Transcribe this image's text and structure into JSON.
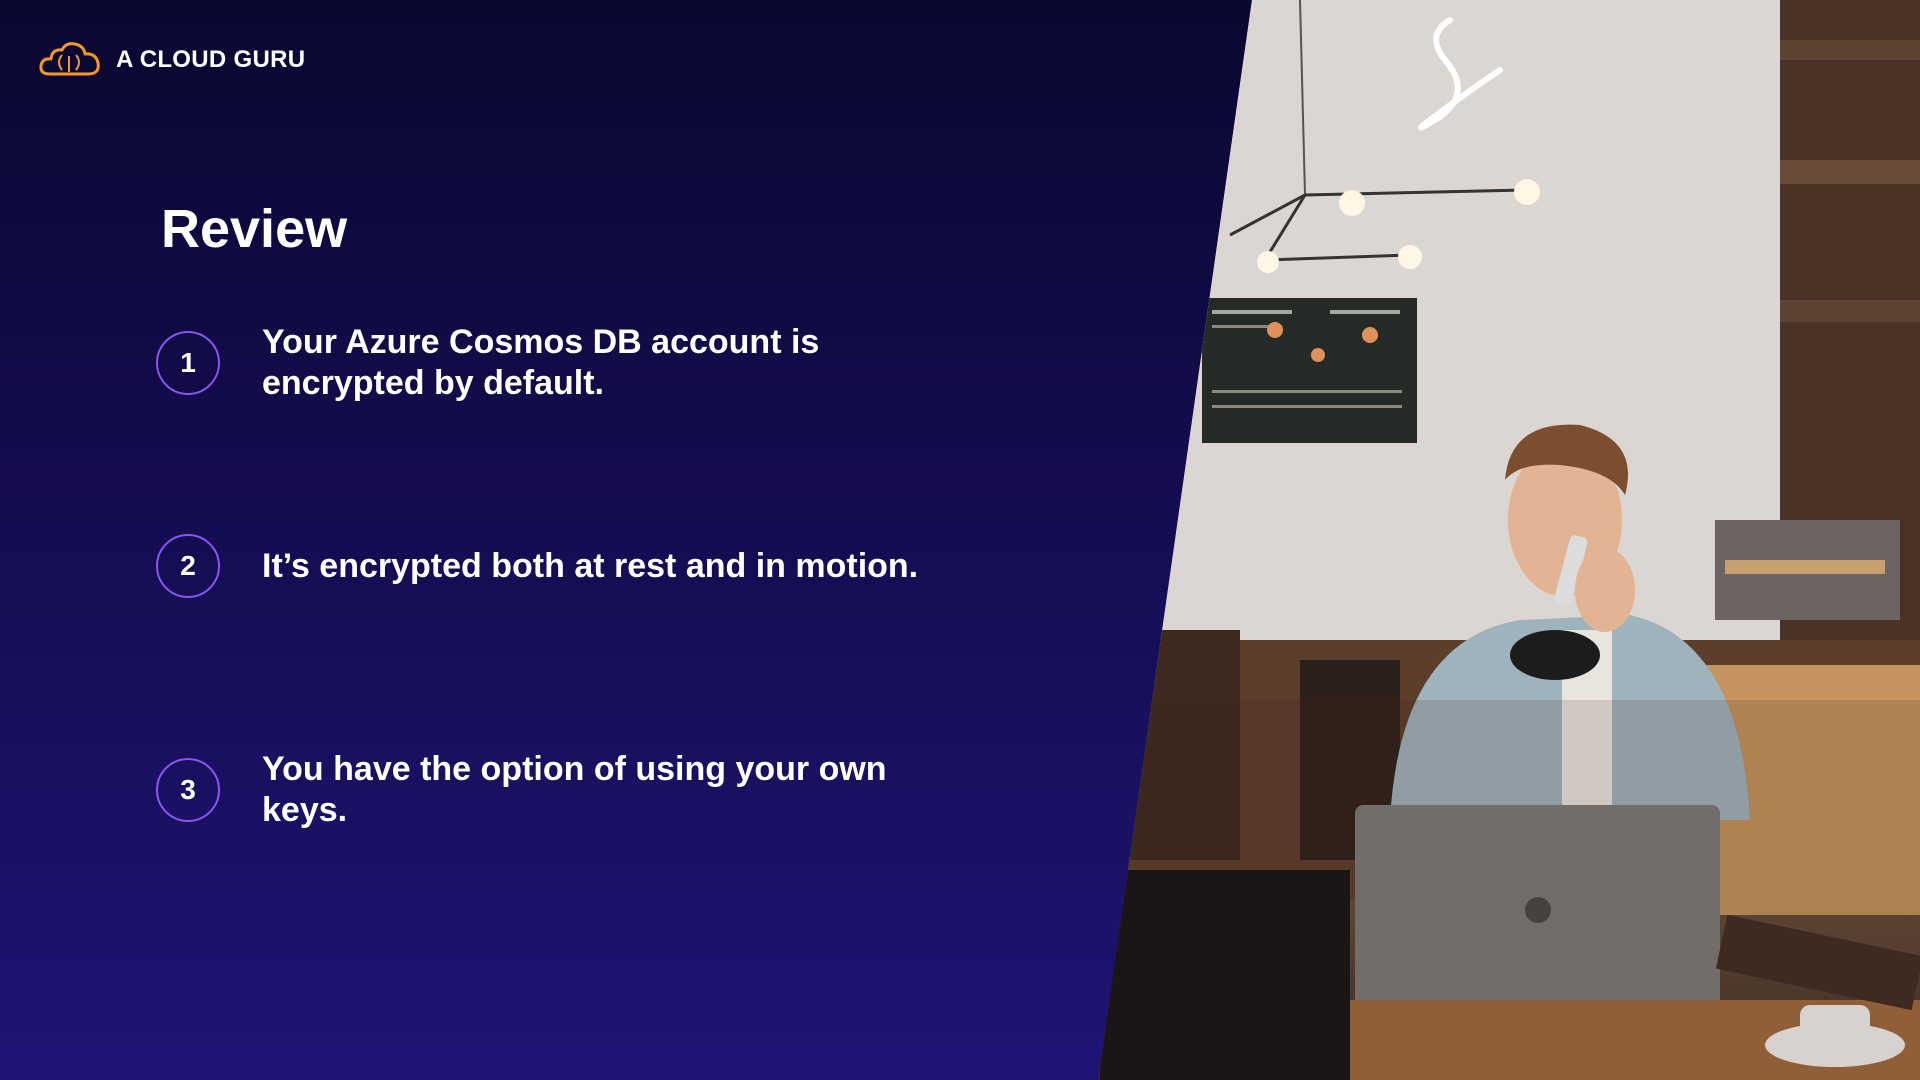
{
  "brand": {
    "name": "A CLOUD GURU",
    "logo_icon": "cloud-logo-icon",
    "logo_color": "#f29a28"
  },
  "slide": {
    "title": "Review",
    "points": [
      {
        "number": "1",
        "text": "Your Azure Cosmos DB account is encrypted by default."
      },
      {
        "number": "2",
        "text": "It’s encrypted both at rest and in motion."
      },
      {
        "number": "3",
        "text": "You have the option of using your own keys."
      }
    ]
  },
  "colors": {
    "background_top": "#0a0730",
    "background_bottom": "#1e1475",
    "circle_border": "#8b55f0",
    "text": "#ffffff"
  },
  "photo": {
    "description_icon": "man-on-phone-at-cafe-photo"
  }
}
